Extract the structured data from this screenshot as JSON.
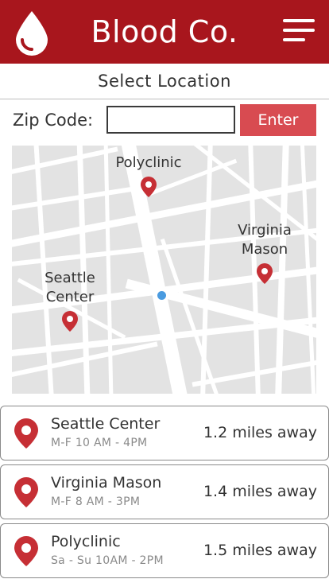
{
  "header": {
    "title": "Blood Co.",
    "logo_icon": "blood-drop-icon",
    "menu_icon": "hamburger-menu-icon"
  },
  "colors": {
    "brand": "#a8161d",
    "button": "#d84b51",
    "map_bg": "#e3e3e3",
    "pin": "#c62f35",
    "user_dot": "#4a9be0"
  },
  "section_title": "Select Location",
  "zip": {
    "label": "Zip Code:",
    "value": "",
    "placeholder": "",
    "button_label": "Enter"
  },
  "map": {
    "labels": {
      "polyclinic": "Polyclinic",
      "virginia_mason": "Virginia\nMason",
      "seattle_center": "Seattle\nCenter"
    }
  },
  "locations": [
    {
      "name": "Seattle Center",
      "hours": "M-F  10 AM - 4PM",
      "distance": "1.2 miles away"
    },
    {
      "name": "Virginia Mason",
      "hours": "M-F 8 AM - 3PM",
      "distance": "1.4 miles away"
    },
    {
      "name": "Polyclinic",
      "hours": "Sa - Su 10AM - 2PM",
      "distance": "1.5 miles away"
    }
  ]
}
